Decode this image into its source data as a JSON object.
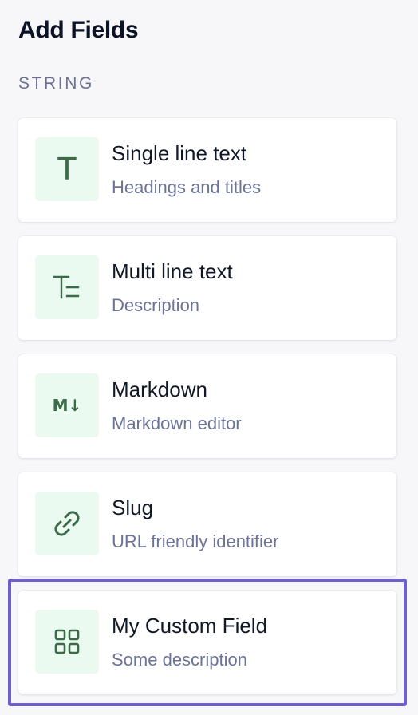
{
  "panel": {
    "title": "Add Fields",
    "section": "STRING"
  },
  "fields": [
    {
      "label": "Single line text",
      "description": "Headings and titles",
      "icon": "text-t-icon",
      "glyph": "T"
    },
    {
      "label": "Multi line text",
      "description": "Description",
      "icon": "multiline-text-icon"
    },
    {
      "label": "Markdown",
      "description": "Markdown editor",
      "icon": "markdown-icon",
      "glyph": "M↓"
    },
    {
      "label": "Slug",
      "description": "URL friendly identifier",
      "icon": "link-icon"
    },
    {
      "label": "My Custom Field",
      "description": "Some description",
      "icon": "grid-icon",
      "highlighted": true
    }
  ],
  "colors": {
    "accent_icon": "#3b6b48",
    "icon_bg": "#ebfaf0",
    "highlight_border": "#6e5fd0",
    "description_text": "#6c7396"
  }
}
